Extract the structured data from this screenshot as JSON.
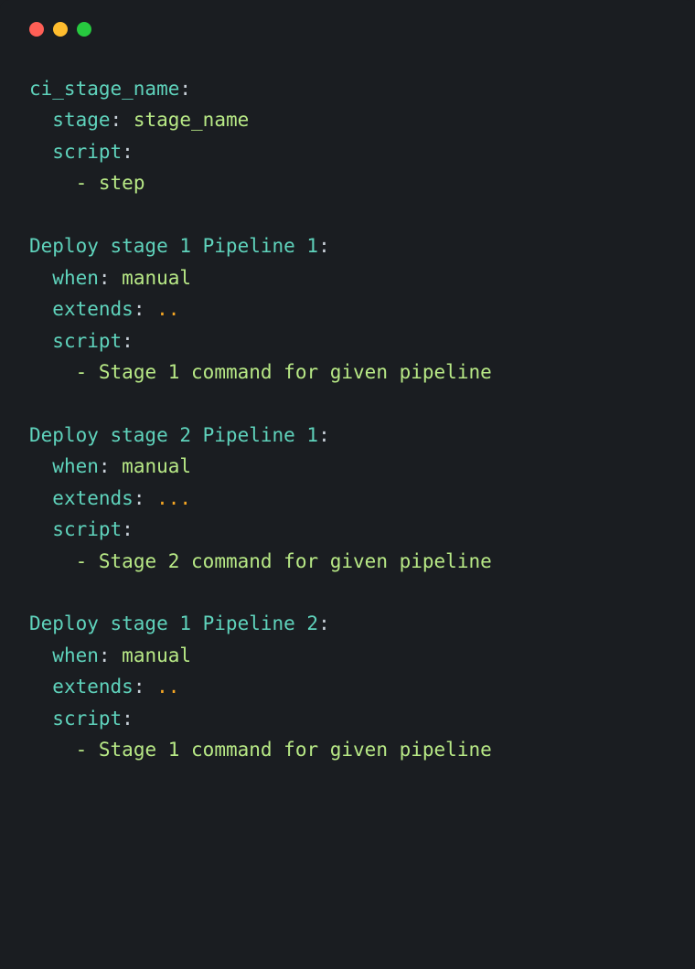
{
  "traffic_lights": {
    "red": "red",
    "yellow": "yellow",
    "green": "green"
  },
  "code": {
    "block1": {
      "key1": "ci_stage_name",
      "key2": "stage",
      "val2": "stage_name",
      "key3": "script",
      "dash1": "-",
      "val3": "step"
    },
    "block2": {
      "key1": "Deploy stage 1 Pipeline 1",
      "key2": "when",
      "val2": "manual",
      "key3": "extends",
      "val3": "..",
      "key4": "script",
      "dash1": "-",
      "val4": "Stage 1 command for given pipeline"
    },
    "block3": {
      "key1": "Deploy stage 2 Pipeline 1",
      "key2": "when",
      "val2": "manual",
      "key3": "extends",
      "val3": "...",
      "key4": "script",
      "dash1": "-",
      "val4": "Stage 2 command for given pipeline"
    },
    "block4": {
      "key1": "Deploy stage 1 Pipeline 2",
      "key2": "when",
      "val2": "manual",
      "key3": "extends",
      "val3": "..",
      "key4": "script",
      "dash1": "-",
      "val4": "Stage 1 command for given pipeline"
    },
    "colon": ":",
    "colon_sp": ": ",
    "sp2": "  ",
    "sp4": "    ",
    "sp": " "
  }
}
